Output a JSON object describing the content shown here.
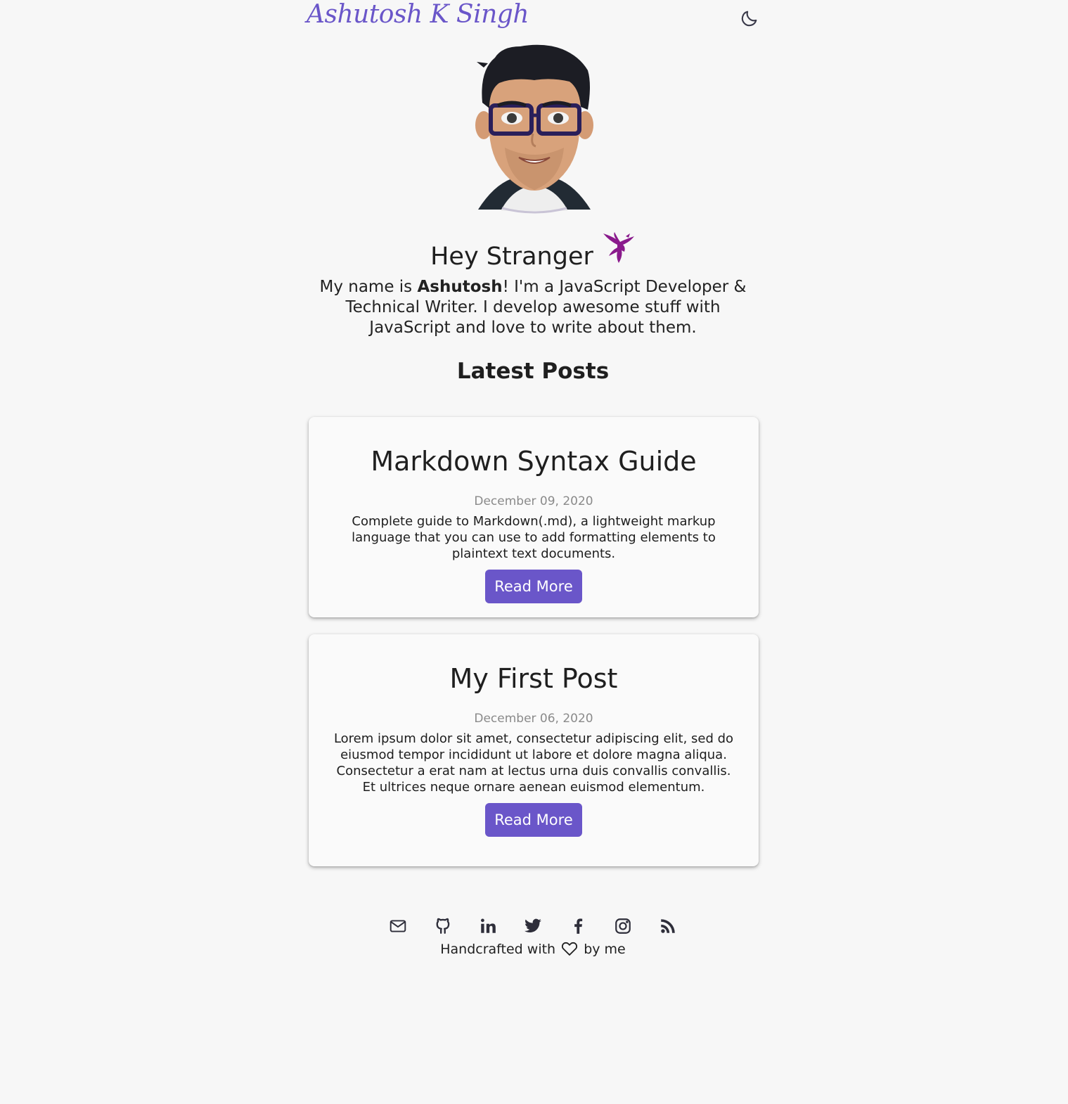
{
  "header": {
    "brand": "Ashutosh K Singh",
    "theme_toggle_icon": "moon-icon"
  },
  "hero": {
    "greeting": "Hey Stranger",
    "greeting_icon": "bird-icon",
    "intro_prefix": "My name is ",
    "intro_name": "Ashutosh",
    "intro_suffix": "! I'm a JavaScript Developer & Technical Writer. I develop awesome stuff with JavaScript and love to write about them."
  },
  "posts": {
    "heading": "Latest Posts",
    "items": [
      {
        "title": "Markdown Syntax Guide",
        "date": "December 09, 2020",
        "excerpt": "Complete guide to Markdown(.md), a lightweight markup language that you can use to add formatting elements to plaintext text documents.",
        "button": "Read More"
      },
      {
        "title": "My First Post",
        "date": "December 06, 2020",
        "excerpt": "Lorem ipsum dolor sit amet, consectetur adipiscing elit, sed do eiusmod tempor incididunt ut labore et dolore magna aliqua. Consectetur a erat nam at lectus urna duis convallis convallis. Et ultrices neque ornare aenean euismod elementum.",
        "button": "Read More"
      }
    ]
  },
  "footer": {
    "social_icons": [
      "mail-icon",
      "github-icon",
      "linkedin-icon",
      "twitter-icon",
      "facebook-icon",
      "instagram-icon",
      "rss-icon"
    ],
    "credit_prefix": "Handcrafted with",
    "credit_suffix": "by me"
  },
  "colors": {
    "accent": "#6a56c9",
    "background": "#f7f7f7",
    "bird": "#8a1a8c"
  }
}
